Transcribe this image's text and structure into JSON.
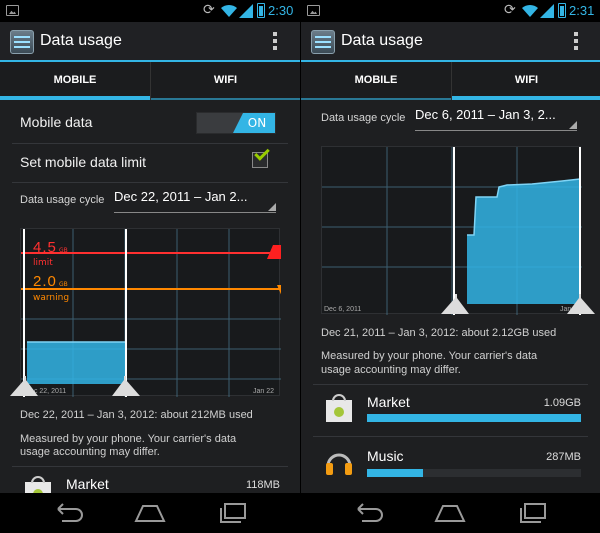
{
  "colors": {
    "accent": "#33b5e5",
    "limit": "#ff3030",
    "warning": "#ff8800",
    "check": "#99cc00"
  },
  "left": {
    "status": {
      "time": "2:30"
    },
    "action_bar": {
      "title": "Data usage",
      "app_icon": "data-usage-icon",
      "overflow_icon": "overflow-menu-icon"
    },
    "tabs": [
      {
        "label": "MOBILE",
        "selected": true
      },
      {
        "label": "WIFI",
        "selected": false
      }
    ],
    "mobile_data": {
      "label": "Mobile data",
      "toggle": "ON"
    },
    "set_limit": {
      "label": "Set mobile data limit",
      "checked": true
    },
    "cycle": {
      "label": "Data usage cycle",
      "value": "Dec 22, 2011 – Jan 2..."
    },
    "chart": {
      "limit": {
        "value": "4.5",
        "unit": "GB",
        "caption": "limit"
      },
      "warning": {
        "value": "2.0",
        "unit": "GB",
        "caption": "warning"
      },
      "x_start": "Dec 22, 2011",
      "x_end": "Jan 22"
    },
    "summary": "Dec 22, 2011 – Jan 3, 2012: about 212MB used",
    "note_line1": "Measured by your phone. Your carrier's data",
    "note_line2": "usage accounting may differ.",
    "apps": [
      {
        "name": "Market",
        "size": "118MB",
        "icon": "market-icon"
      }
    ]
  },
  "right": {
    "status": {
      "time": "2:31"
    },
    "action_bar": {
      "title": "Data usage",
      "app_icon": "data-usage-icon",
      "overflow_icon": "overflow-menu-icon"
    },
    "tabs": [
      {
        "label": "MOBILE",
        "selected": false
      },
      {
        "label": "WIFI",
        "selected": true
      }
    ],
    "cycle": {
      "label": "Data usage cycle",
      "value": "Dec 6, 2011 – Jan 3, 2..."
    },
    "chart": {
      "x_start": "Dec 6, 2011",
      "x_end": "Jan 5"
    },
    "summary": "Dec 21, 2011 – Jan 3, 2012: about 2.12GB used",
    "note_line1": "Measured by your phone. Your carrier's data",
    "note_line2": "usage accounting may differ.",
    "apps": [
      {
        "name": "Market",
        "size": "1.09GB",
        "icon": "market-icon",
        "fraction": 1.0
      },
      {
        "name": "Music",
        "size": "287MB",
        "icon": "headphones-icon",
        "fraction": 0.26
      }
    ]
  },
  "nav": {
    "back": "back-icon",
    "home": "home-icon",
    "recents": "recent-apps-icon"
  }
}
